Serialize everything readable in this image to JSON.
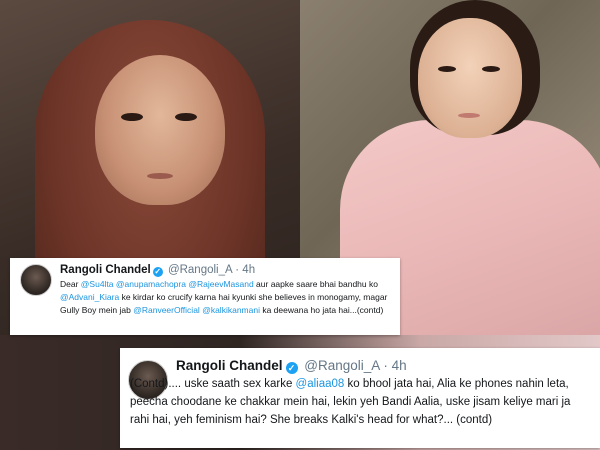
{
  "tweets": [
    {
      "name": "Rangoli Chandel",
      "handle": "@Rangoli_A",
      "separator": "·",
      "time": "4h",
      "segments": [
        {
          "text": "Dear ",
          "type": "text"
        },
        {
          "text": "@Su4lta",
          "type": "mention"
        },
        {
          "text": " ",
          "type": "text"
        },
        {
          "text": "@anupamachopra",
          "type": "mention"
        },
        {
          "text": " ",
          "type": "text"
        },
        {
          "text": "@RajeevMasand",
          "type": "mention"
        },
        {
          "text": " aur aapke saare bhai bandhu ko ",
          "type": "text"
        },
        {
          "text": "@Advani_Kiara",
          "type": "mention"
        },
        {
          "text": " ke kirdar ko crucify karna hai kyunki she believes in monogamy, magar Gully Boy mein jab ",
          "type": "text"
        },
        {
          "text": "@RanveerOfficial",
          "type": "mention"
        },
        {
          "text": " ",
          "type": "text"
        },
        {
          "text": "@kalkikanmani",
          "type": "mention"
        },
        {
          "text": " ka deewana ho jata hai...(contd)",
          "type": "text"
        }
      ]
    },
    {
      "name": "Rangoli Chandel",
      "handle": "@Rangoli_A",
      "separator": "·",
      "time": "4h",
      "segments": [
        {
          "text": "(Contd).... uske saath sex karke ",
          "type": "text"
        },
        {
          "text": "@aliaa08",
          "type": "mention"
        },
        {
          "text": " ko bhool jata hai, Alia ke phones nahin leta, peecha choodane ke chakkar mein hai, lekin yeh Bandi Aalia, uske jisam keliye mari ja rahi hai, yeh feminism hai? She breaks Kalki's head for what?... (contd)",
          "type": "text"
        }
      ]
    }
  ],
  "icons": {
    "verified": "verified-badge-icon",
    "avatar": "profile-avatar"
  },
  "colors": {
    "mention": "#1b95e0",
    "verified": "#1da1f2",
    "meta": "#657786"
  }
}
